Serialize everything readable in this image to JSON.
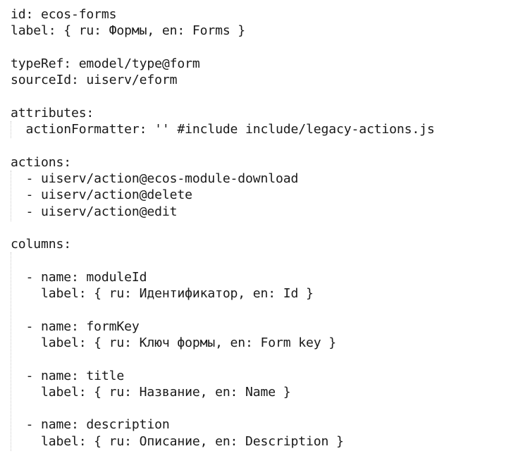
{
  "document": {
    "lines": [
      "id: ecos-forms",
      "label: { ru: Формы, en: Forms }",
      "",
      "typeRef: emodel/type@form",
      "sourceId: uiserv/eform",
      "",
      "attributes:",
      "  actionFormatter: '' #include include/legacy-actions.js",
      "",
      "actions:",
      "  - uiserv/action@ecos-module-download",
      "  - uiserv/action@delete",
      "  - uiserv/action@edit",
      "",
      "columns:",
      "",
      "  - name: moduleId",
      "    label: { ru: Идентификатор, en: Id }",
      "",
      "  - name: formKey",
      "    label: { ru: Ключ формы, en: Form key }",
      "",
      "  - name: title",
      "    label: { ru: Название, en: Name }",
      "",
      "  - name: description",
      "    label: { ru: Описание, en: Description }"
    ]
  }
}
